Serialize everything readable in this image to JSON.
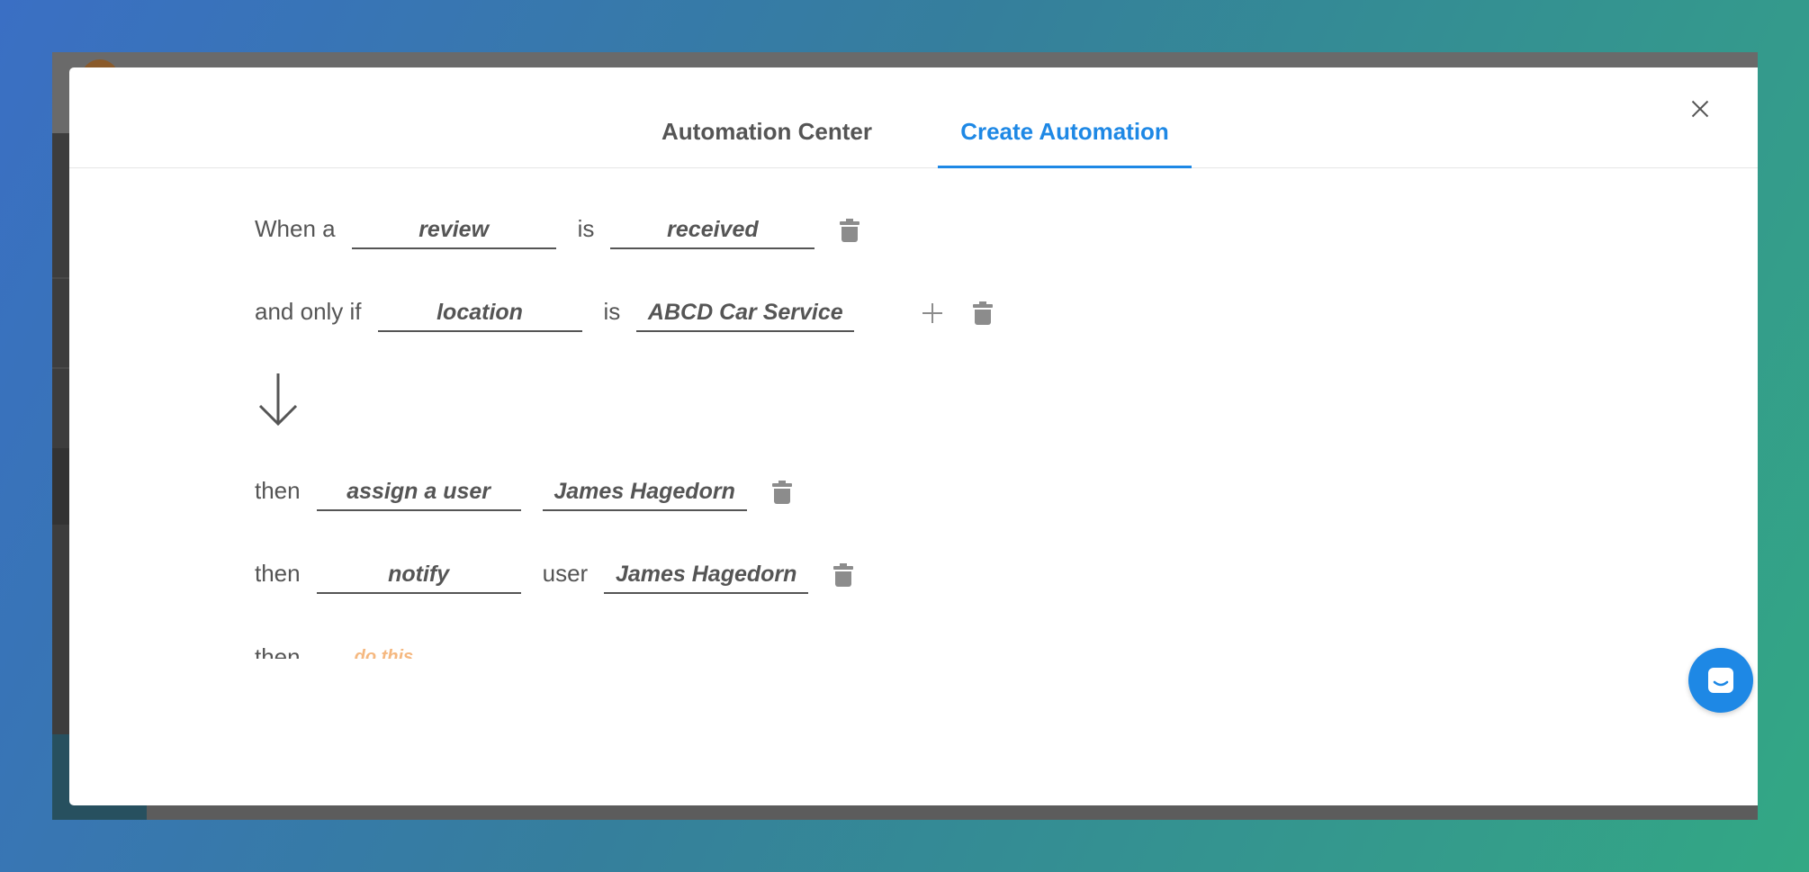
{
  "tabs": [
    {
      "label": "Automation Center",
      "active": false
    },
    {
      "label": "Create Automation",
      "active": true
    }
  ],
  "accent_color": "#1e88e5",
  "trigger": {
    "prefix": "When a",
    "subject": "review",
    "verb": "is",
    "event": "received"
  },
  "condition": {
    "prefix": "and only if",
    "field": "location",
    "operator": "is",
    "value": "ABCD Car Service"
  },
  "actions": [
    {
      "prefix": "then",
      "action": "assign a user",
      "value": "James Hagedorn"
    },
    {
      "prefix": "then",
      "action": "notify",
      "middle": "user",
      "value": "James Hagedorn"
    }
  ],
  "pending_action": {
    "prefix": "then",
    "placeholder": "do this"
  },
  "icons": {
    "close": "close-icon",
    "delete": "trash-icon",
    "add": "plus-icon",
    "flow": "arrow-down-icon",
    "chat": "chat-icon"
  }
}
